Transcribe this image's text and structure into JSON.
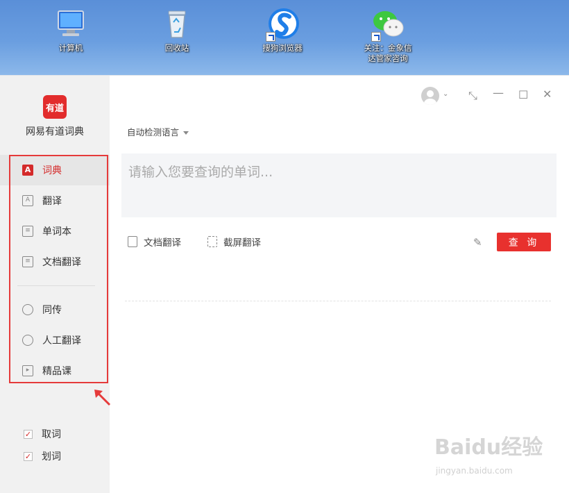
{
  "desktop": {
    "icons": [
      {
        "label": "计算机",
        "icon": "computer-icon"
      },
      {
        "label": "回收站",
        "icon": "recycle-bin-icon"
      },
      {
        "label": "搜狗浏览器",
        "icon": "sogou-browser-icon"
      },
      {
        "label_line1": "关注：金象信",
        "label_line2": "达管家咨询",
        "icon": "wechat-icon"
      }
    ]
  },
  "app": {
    "logo_text": "有道",
    "name": "网易有道词典",
    "brand_color": "#e8312e",
    "nav": [
      {
        "label": "词典",
        "icon": "dictionary-icon",
        "active": true
      },
      {
        "label": "翻译",
        "icon": "translate-icon"
      },
      {
        "label": "单词本",
        "icon": "wordbook-icon"
      },
      {
        "label": "文档翻译",
        "icon": "document-icon"
      },
      {
        "label": "同传",
        "icon": "simultaneous-icon"
      },
      {
        "label": "人工翻译",
        "icon": "human-translate-icon"
      },
      {
        "label": "精品课",
        "icon": "course-icon"
      }
    ],
    "options": [
      {
        "label": "取词",
        "checked": true
      },
      {
        "label": "划词",
        "checked": true
      }
    ]
  },
  "main": {
    "language_select": "自动检测语言",
    "query_placeholder": "请输入您要查询的单词...",
    "tools": [
      {
        "label": "文档翻译",
        "icon": "document-icon"
      },
      {
        "label": "截屏翻译",
        "icon": "screenshot-icon"
      }
    ],
    "search_button": "查 询"
  },
  "watermark": {
    "main": "Baidu经验",
    "sub": "jingyan.baidu.com"
  }
}
